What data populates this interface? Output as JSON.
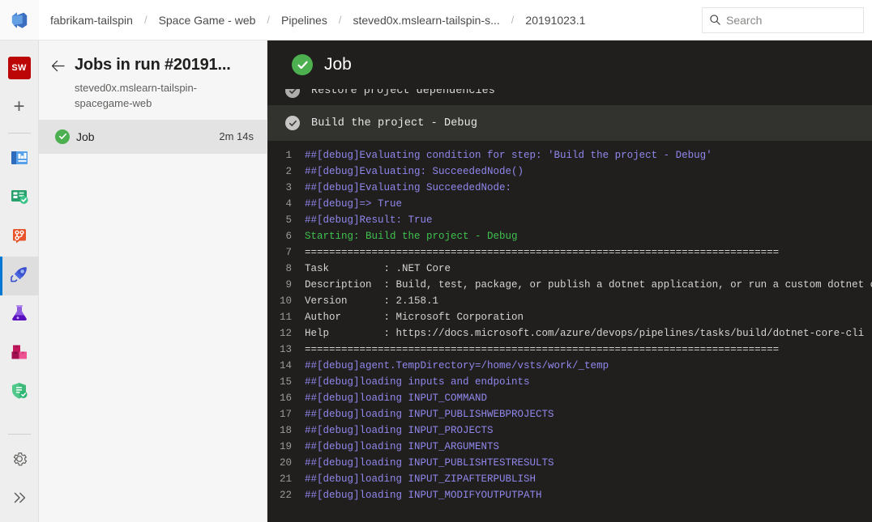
{
  "topbar": {
    "logo_icon": "azure-devops-logo",
    "breadcrumb": [
      {
        "label": "fabrikam-tailspin"
      },
      {
        "label": "Space Game - web"
      },
      {
        "label": "Pipelines"
      },
      {
        "label": "steved0x.mslearn-tailspin-s..."
      },
      {
        "label": "20191023.1"
      }
    ],
    "separator": "/",
    "search": {
      "placeholder": "Search",
      "value": "",
      "icon": "search-icon"
    }
  },
  "rail": {
    "project_badge": "SW",
    "items": [
      {
        "name": "new-item",
        "icon": "plus-icon",
        "label": "+"
      },
      {
        "name": "overview",
        "icon": "overview-icon",
        "label": "Overview"
      },
      {
        "name": "boards",
        "icon": "boards-icon",
        "label": "Boards"
      },
      {
        "name": "repos",
        "icon": "repos-icon",
        "label": "Repos"
      },
      {
        "name": "pipelines",
        "icon": "pipelines-rocket-icon",
        "label": "Pipelines",
        "active": true
      },
      {
        "name": "test-plans",
        "icon": "test-plans-flask-icon",
        "label": "Test Plans"
      },
      {
        "name": "artifacts",
        "icon": "artifacts-boxes-icon",
        "label": "Artifacts"
      },
      {
        "name": "advanced-security",
        "icon": "shield-check-icon",
        "label": "Advanced Security"
      }
    ],
    "settings": {
      "name": "project-settings",
      "icon": "gear-icon",
      "label": "Project settings"
    },
    "expand": {
      "name": "expand-rail",
      "icon": "chevron-double-right-icon",
      "label": ">>"
    }
  },
  "jobs_panel": {
    "back_label": "←",
    "title": "Jobs in run #20191...",
    "subtitle": "steved0x.mslearn-tailspin-spacegame-web",
    "rows": [
      {
        "status": "succeeded",
        "name": "Job",
        "duration": "2m 14s",
        "selected": true
      }
    ]
  },
  "log": {
    "header_title": "Job",
    "header_status": "succeeded",
    "partial_step": {
      "status": "succeeded-grey",
      "title": "Restore project dependencies"
    },
    "current_step": {
      "status": "succeeded-grey",
      "title": "Build the project - Debug"
    },
    "lines": [
      {
        "n": "1",
        "segments": [
          {
            "t": "##[debug]",
            "c": "c-debug"
          },
          {
            "t": "Evaluating condition for step: 'Build the project - Debug'",
            "c": "c-debug"
          }
        ]
      },
      {
        "n": "2",
        "segments": [
          {
            "t": "##[debug]",
            "c": "c-debug"
          },
          {
            "t": "Evaluating: SucceededNode()",
            "c": "c-debug"
          }
        ]
      },
      {
        "n": "3",
        "segments": [
          {
            "t": "##[debug]",
            "c": "c-debug"
          },
          {
            "t": "Evaluating SucceededNode:",
            "c": "c-debug"
          }
        ]
      },
      {
        "n": "4",
        "segments": [
          {
            "t": "##[debug]",
            "c": "c-debug"
          },
          {
            "t": "=> True",
            "c": "c-debug"
          }
        ]
      },
      {
        "n": "5",
        "segments": [
          {
            "t": "##[debug]",
            "c": "c-debug"
          },
          {
            "t": "Result: True",
            "c": "c-debug"
          }
        ]
      },
      {
        "n": "6",
        "segments": [
          {
            "t": "Starting: Build the project - Debug",
            "c": "c-green"
          }
        ]
      },
      {
        "n": "7",
        "segments": [
          {
            "t": "==============================================================================",
            "c": "c-white"
          }
        ]
      },
      {
        "n": "8",
        "segments": [
          {
            "t": "Task         : .NET Core",
            "c": "c-white"
          }
        ]
      },
      {
        "n": "9",
        "segments": [
          {
            "t": "Description  : Build, test, package, or publish a dotnet application, or run a custom dotnet command",
            "c": "c-white"
          }
        ]
      },
      {
        "n": "10",
        "segments": [
          {
            "t": "Version      : 2.158.1",
            "c": "c-white"
          }
        ]
      },
      {
        "n": "11",
        "segments": [
          {
            "t": "Author       : Microsoft Corporation",
            "c": "c-white"
          }
        ]
      },
      {
        "n": "12",
        "segments": [
          {
            "t": "Help         : https://docs.microsoft.com/azure/devops/pipelines/tasks/build/dotnet-core-cli",
            "c": "c-white"
          }
        ]
      },
      {
        "n": "13",
        "segments": [
          {
            "t": "==============================================================================",
            "c": "c-white"
          }
        ]
      },
      {
        "n": "14",
        "segments": [
          {
            "t": "##[debug]",
            "c": "c-debug"
          },
          {
            "t": "agent.TempDirectory=/home/vsts/work/_temp",
            "c": "c-debug"
          }
        ]
      },
      {
        "n": "15",
        "segments": [
          {
            "t": "##[debug]",
            "c": "c-debug"
          },
          {
            "t": "loading inputs and endpoints",
            "c": "c-debug"
          }
        ]
      },
      {
        "n": "16",
        "segments": [
          {
            "t": "##[debug]",
            "c": "c-debug"
          },
          {
            "t": "loading INPUT_COMMAND",
            "c": "c-debug"
          }
        ]
      },
      {
        "n": "17",
        "segments": [
          {
            "t": "##[debug]",
            "c": "c-debug"
          },
          {
            "t": "loading INPUT_PUBLISHWEBPROJECTS",
            "c": "c-debug"
          }
        ]
      },
      {
        "n": "18",
        "segments": [
          {
            "t": "##[debug]",
            "c": "c-debug"
          },
          {
            "t": "loading INPUT_PROJECTS",
            "c": "c-debug"
          }
        ]
      },
      {
        "n": "19",
        "segments": [
          {
            "t": "##[debug]",
            "c": "c-debug"
          },
          {
            "t": "loading INPUT_ARGUMENTS",
            "c": "c-debug"
          }
        ]
      },
      {
        "n": "20",
        "segments": [
          {
            "t": "##[debug]",
            "c": "c-debug"
          },
          {
            "t": "loading INPUT_PUBLISHTESTRESULTS",
            "c": "c-debug"
          }
        ]
      },
      {
        "n": "21",
        "segments": [
          {
            "t": "##[debug]",
            "c": "c-debug"
          },
          {
            "t": "loading INPUT_ZIPAFTERPUBLISH",
            "c": "c-debug"
          }
        ]
      },
      {
        "n": "22",
        "segments": [
          {
            "t": "##[debug]",
            "c": "c-debug"
          },
          {
            "t": "loading INPUT_MODIFYOUTPUTPATH",
            "c": "c-debug"
          }
        ]
      }
    ]
  },
  "colors": {
    "accent": "#0078d4",
    "success": "#4caf50",
    "log_bg": "#211f1e",
    "step_bg": "#32322f",
    "debug_purple": "#8f87ec",
    "green_text": "#3ec14f",
    "project_badge_bg": "#bc0606"
  }
}
